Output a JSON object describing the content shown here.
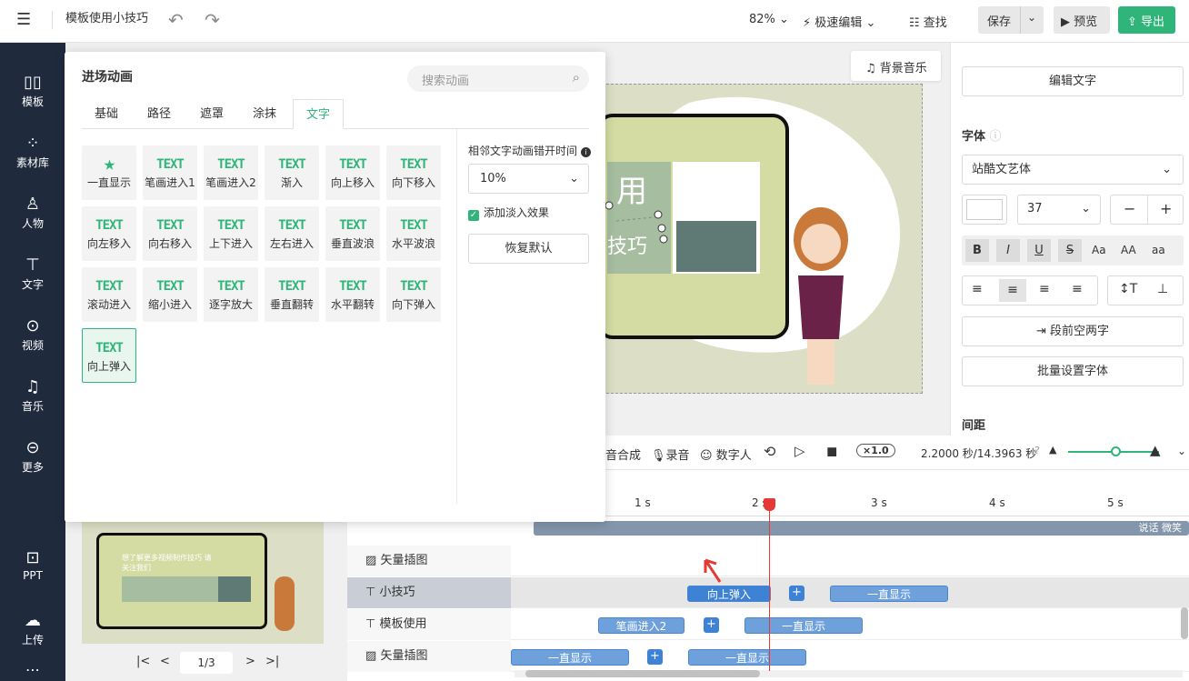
{
  "topbar": {
    "doc_title": "模板使用小技巧",
    "zoom": "82%",
    "fast_edit": "极速编辑",
    "find": "查找",
    "save": "保存",
    "preview": "预览",
    "export": "导出"
  },
  "sidebar": {
    "items": [
      {
        "label": "模板",
        "icon": "template-icon"
      },
      {
        "label": "素材库",
        "icon": "library-icon"
      },
      {
        "label": "人物",
        "icon": "person-icon"
      },
      {
        "label": "文字",
        "icon": "text-icon"
      },
      {
        "label": "视频",
        "icon": "video-icon"
      },
      {
        "label": "音乐",
        "icon": "music-icon"
      },
      {
        "label": "更多",
        "icon": "more-icon"
      },
      {
        "label": "PPT",
        "icon": "ppt-icon"
      },
      {
        "label": "上传",
        "icon": "upload-icon"
      }
    ]
  },
  "canvas": {
    "bg_music": "背景音乐",
    "slide_text": "用",
    "slide_text2": "技巧"
  },
  "right_panel": {
    "edit_text": "编辑文字",
    "font_label": "字体",
    "font_value": "站酷文艺体",
    "font_size": "37",
    "indent": "段前空两字",
    "batch_font": "批量设置字体",
    "spacing": "间距"
  },
  "popup": {
    "title": "进场动画",
    "search_placeholder": "搜索动画",
    "tabs": [
      "基础",
      "路径",
      "遮罩",
      "涂抹",
      "文字"
    ],
    "active_tab": "文字",
    "animations": [
      {
        "name": "一直显示",
        "art": "★"
      },
      {
        "name": "笔画进入1",
        "art": "TEXT"
      },
      {
        "name": "笔画进入2",
        "art": "TEXT"
      },
      {
        "name": "渐入",
        "art": "TEXT"
      },
      {
        "name": "向上移入",
        "art": "TEXT"
      },
      {
        "name": "向下移入",
        "art": "TEXT"
      },
      {
        "name": "向左移入",
        "art": "TEXT"
      },
      {
        "name": "向右移入",
        "art": "TEXT"
      },
      {
        "name": "上下进入",
        "art": "TEXT"
      },
      {
        "name": "左右进入",
        "art": "TEXT"
      },
      {
        "name": "垂直波浪",
        "art": "TEXT"
      },
      {
        "name": "水平波浪",
        "art": "TEXT"
      },
      {
        "name": "滚动进入",
        "art": "TEXT"
      },
      {
        "name": "缩小进入",
        "art": "TEXT"
      },
      {
        "name": "逐字放大",
        "art": "TEXT"
      },
      {
        "name": "垂直翻转",
        "art": "TEXT"
      },
      {
        "name": "水平翻转",
        "art": "TEXT"
      },
      {
        "name": "向下弹入",
        "art": "TEXT"
      },
      {
        "name": "向上弹入",
        "art": "TEXT"
      }
    ],
    "selected_animation": "向上弹入",
    "option_label": "相邻文字动画错开时间",
    "option_value": "10%",
    "fade_option": "添加淡入效果",
    "reset": "恢复默认"
  },
  "timeline": {
    "controls": {
      "synth": "音合成",
      "record": "录音",
      "digital_human": "数字人",
      "speed": "×1.0",
      "time": "2.2000 秒/14.3963 秒"
    },
    "ruler": [
      "1 s",
      "2 s",
      "3 s",
      "4 s",
      "5 s"
    ],
    "tracks": [
      {
        "label": "矢量插图",
        "clips": []
      },
      {
        "label": "小技巧",
        "clips": [
          "向上弹入",
          "一直显示"
        ]
      },
      {
        "label": "模板使用",
        "clips": [
          "笔画进入2",
          "一直显示"
        ]
      },
      {
        "label": "矢量插图",
        "clips": [
          "一直显示",
          "一直显示"
        ]
      }
    ],
    "top_clip": "说话 微笑",
    "page_indicator": "1/3",
    "thumb_text": "想了解更多视频制作技巧 请关注我们"
  },
  "colors": {
    "accent": "#2fb57a",
    "sidebar": "#1f2a3d",
    "clip": "#6ea1dc",
    "playhead": "#e53935"
  }
}
